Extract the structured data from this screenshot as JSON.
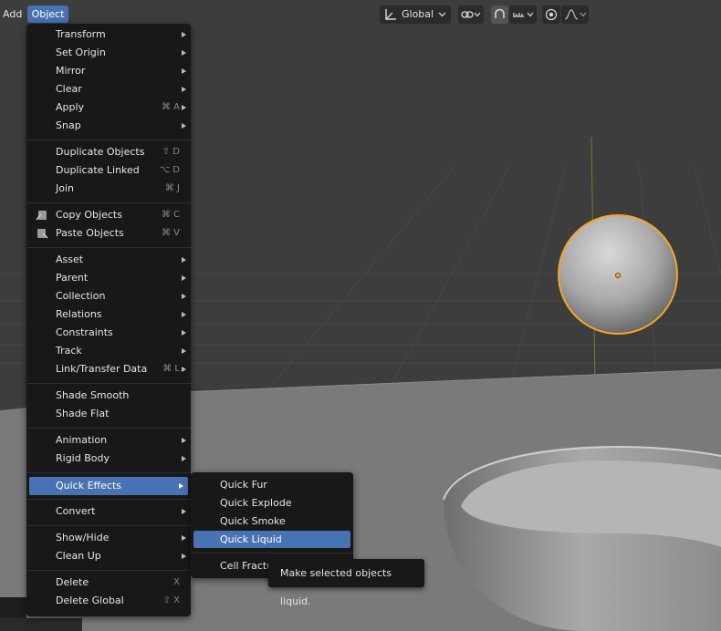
{
  "header": {
    "menus": [
      "Add",
      "Object"
    ],
    "transform_orientation": "Global"
  },
  "object_menu": {
    "groups": [
      [
        {
          "label": "Transform",
          "submenu": true
        },
        {
          "label": "Set Origin",
          "submenu": true
        },
        {
          "label": "Mirror",
          "submenu": true
        },
        {
          "label": "Clear",
          "submenu": true
        },
        {
          "label": "Apply",
          "shortcut": "⌘ A",
          "submenu": true
        },
        {
          "label": "Snap",
          "submenu": true
        }
      ],
      [
        {
          "label": "Duplicate Objects",
          "shortcut": "⇧ D"
        },
        {
          "label": "Duplicate Linked",
          "shortcut": "⌥ D"
        },
        {
          "label": "Join",
          "shortcut": "⌘ J"
        }
      ],
      [
        {
          "label": "Copy Objects",
          "shortcut": "⌘ C",
          "icon": "copy-icon"
        },
        {
          "label": "Paste Objects",
          "shortcut": "⌘ V",
          "icon": "paste-icon"
        }
      ],
      [
        {
          "label": "Asset",
          "submenu": true
        },
        {
          "label": "Parent",
          "submenu": true
        },
        {
          "label": "Collection",
          "submenu": true
        },
        {
          "label": "Relations",
          "submenu": true
        },
        {
          "label": "Constraints",
          "submenu": true
        },
        {
          "label": "Track",
          "submenu": true
        },
        {
          "label": "Link/Transfer Data",
          "shortcut": "⌘ L",
          "submenu": true
        }
      ],
      [
        {
          "label": "Shade Smooth"
        },
        {
          "label": "Shade Flat"
        }
      ],
      [
        {
          "label": "Animation",
          "submenu": true
        },
        {
          "label": "Rigid Body",
          "submenu": true
        }
      ],
      [
        {
          "label": "Quick Effects",
          "submenu": true,
          "active": true
        }
      ],
      [
        {
          "label": "Convert",
          "submenu": true
        }
      ],
      [
        {
          "label": "Show/Hide",
          "submenu": true
        },
        {
          "label": "Clean Up",
          "submenu": true
        }
      ],
      [
        {
          "label": "Delete",
          "shortcut": "X"
        },
        {
          "label": "Delete Global",
          "shortcut": "⇧ X"
        }
      ]
    ]
  },
  "quick_effects_menu": {
    "items": [
      {
        "label": "Quick Fur"
      },
      {
        "label": "Quick Explode"
      },
      {
        "label": "Quick Smoke"
      },
      {
        "label": "Quick Liquid",
        "active": true
      },
      {
        "label": "Cell Fractu"
      }
    ]
  },
  "tooltip": {
    "text": "Make selected objects liquid."
  },
  "colors": {
    "menu_bg": "#181818",
    "highlight": "#4772b3",
    "selection_outline": "#f5a623"
  }
}
